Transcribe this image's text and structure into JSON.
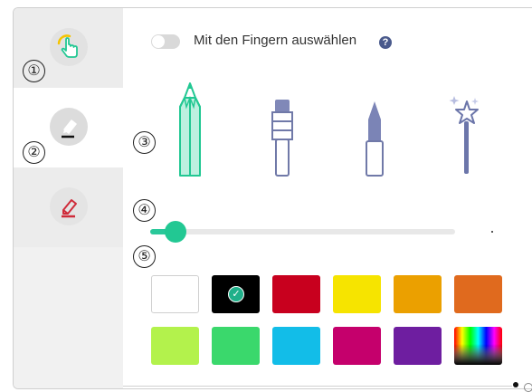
{
  "sidebar": {
    "tabs": [
      {
        "name": "finger-select",
        "icon": "hand-pointer-icon",
        "number": "①"
      },
      {
        "name": "pen",
        "icon": "pen-icon",
        "number": "②"
      },
      {
        "name": "eraser",
        "icon": "eraser-icon"
      }
    ]
  },
  "toggle": {
    "label": "Mit den Fingern auswählen",
    "checked": false,
    "help": "?"
  },
  "tools": {
    "number": "③",
    "items": [
      {
        "name": "pencil",
        "icon": "pencil-icon",
        "selected": true
      },
      {
        "name": "brush",
        "icon": "brush-icon",
        "selected": false
      },
      {
        "name": "marker",
        "icon": "marker-icon",
        "selected": false
      },
      {
        "name": "magic-wand",
        "icon": "magic-wand-icon",
        "selected": false
      }
    ]
  },
  "stroke_size": {
    "number": "④",
    "value_fraction": 0.08
  },
  "colors": {
    "number": "⑤",
    "selected_index": 1,
    "swatches": [
      {
        "name": "white",
        "hex": "#ffffff"
      },
      {
        "name": "black",
        "hex": "#000000"
      },
      {
        "name": "red",
        "hex": "#c8001e"
      },
      {
        "name": "yellow",
        "hex": "#f6e400"
      },
      {
        "name": "orange",
        "hex": "#eba000"
      },
      {
        "name": "dark-orange",
        "hex": "#e06a1e"
      },
      {
        "name": "lime",
        "hex": "#b3f24c"
      },
      {
        "name": "green",
        "hex": "#3ad86c"
      },
      {
        "name": "cyan",
        "hex": "#12bde8"
      },
      {
        "name": "magenta",
        "hex": "#c5006c"
      },
      {
        "name": "purple",
        "hex": "#6e1ea0"
      },
      {
        "name": "custom-spectrum",
        "hex": "spectrum"
      }
    ]
  },
  "accent": "#22c893"
}
